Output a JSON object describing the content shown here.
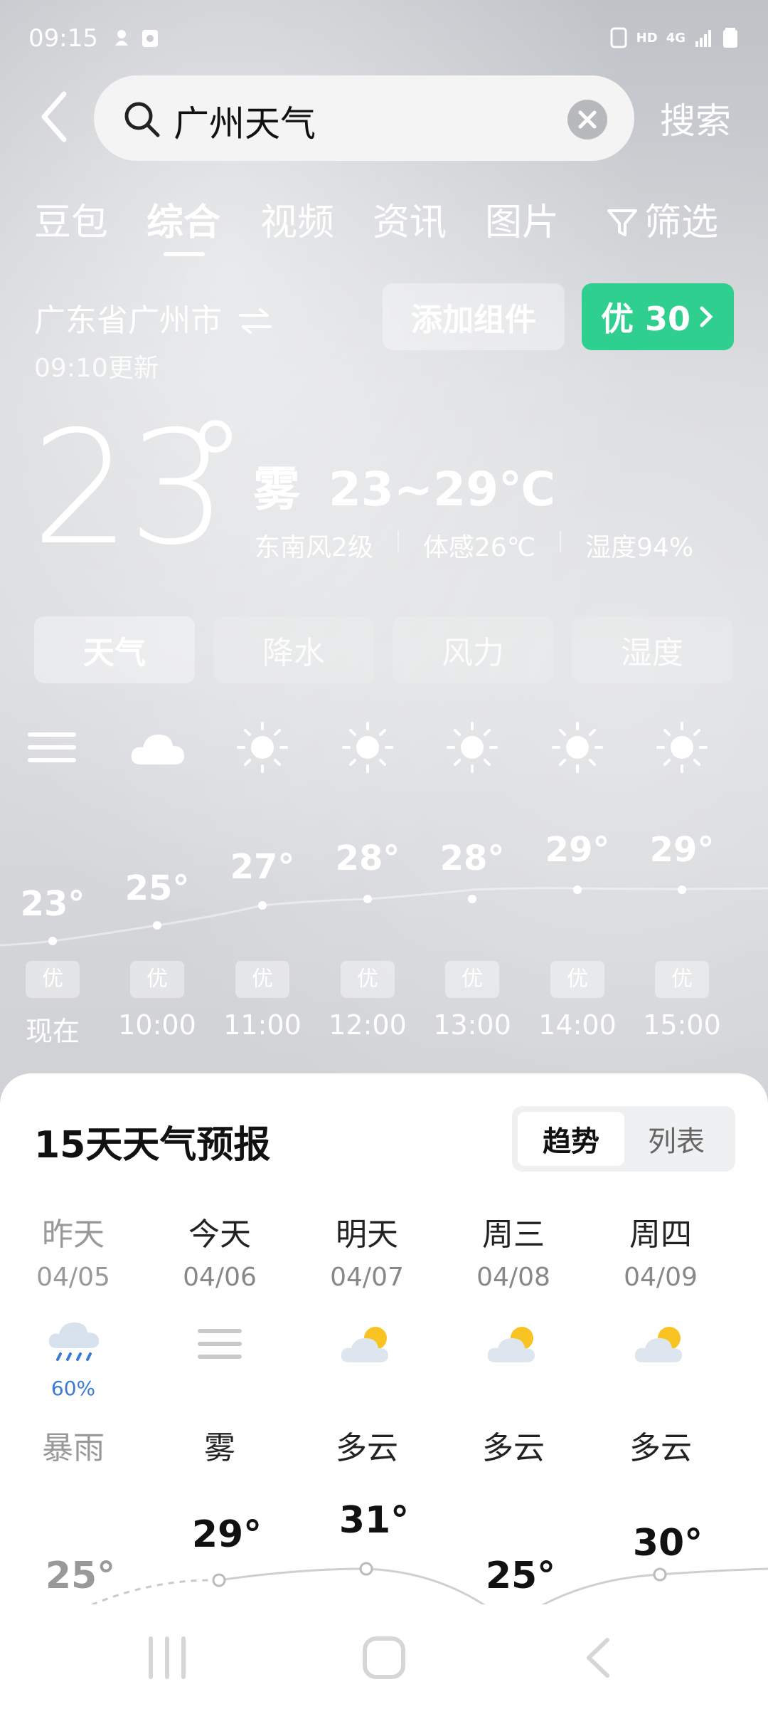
{
  "status_bar": {
    "time": "09:15",
    "indicators": [
      "HD",
      "4G"
    ],
    "icons": [
      "notification-icon",
      "calendar-icon",
      "nfc-icon",
      "signal-icon",
      "battery-icon"
    ]
  },
  "search": {
    "query": "广州天气",
    "search_button": "搜索"
  },
  "tabs": [
    {
      "label": "豆包",
      "active": false
    },
    {
      "label": "综合",
      "active": true
    },
    {
      "label": "视频",
      "active": false
    },
    {
      "label": "资讯",
      "active": false
    },
    {
      "label": "图片",
      "active": false
    },
    {
      "label": "筛选",
      "active": false
    }
  ],
  "location": {
    "name": "广东省广州市",
    "updated": "09:10更新"
  },
  "buttons": {
    "add_widget": "添加组件",
    "aqi": "优 30"
  },
  "current": {
    "temp": "23",
    "condition": "雾",
    "range": "23~29℃",
    "wind": "东南风2级",
    "feels_like": "体感26℃",
    "humidity": "湿度94%"
  },
  "segments": [
    {
      "label": "天气",
      "active": true
    },
    {
      "label": "降水",
      "active": false
    },
    {
      "label": "风力",
      "active": false
    },
    {
      "label": "湿度",
      "active": false
    }
  ],
  "hourly": [
    {
      "time": "现在",
      "temp": "23°",
      "aqi": "优",
      "icon": "fog-icon"
    },
    {
      "time": "10:00",
      "temp": "25°",
      "aqi": "优",
      "icon": "cloud-icon"
    },
    {
      "time": "11:00",
      "temp": "27°",
      "aqi": "优",
      "icon": "sun-icon"
    },
    {
      "time": "12:00",
      "temp": "28°",
      "aqi": "优",
      "icon": "sun-icon"
    },
    {
      "time": "13:00",
      "temp": "28°",
      "aqi": "优",
      "icon": "sun-icon"
    },
    {
      "time": "14:00",
      "temp": "29°",
      "aqi": "优",
      "icon": "sun-icon"
    },
    {
      "time": "15:00",
      "temp": "29°",
      "aqi": "优",
      "icon": "sun-icon"
    }
  ],
  "forecast": {
    "title": "15天天气预报",
    "toggle": {
      "trend": "趋势",
      "list": "列表"
    },
    "days": [
      {
        "name": "昨天",
        "date": "04/05",
        "condition": "暴雨",
        "precip": "60%",
        "high": "25°",
        "icon": "rain-icon"
      },
      {
        "name": "今天",
        "date": "04/06",
        "condition": "雾",
        "precip": "",
        "high": "29°",
        "icon": "fog-icon"
      },
      {
        "name": "明天",
        "date": "04/07",
        "condition": "多云",
        "precip": "",
        "high": "31°",
        "icon": "partly-cloudy-icon"
      },
      {
        "name": "周三",
        "date": "04/08",
        "condition": "多云",
        "precip": "",
        "high": "25°",
        "icon": "partly-cloudy-icon"
      },
      {
        "name": "周四",
        "date": "04/09",
        "condition": "多云",
        "precip": "",
        "high": "30°",
        "icon": "partly-cloudy-icon"
      }
    ]
  },
  "colors": {
    "accent_green": "#2fcf8f",
    "rain_blue": "#3a7bd5"
  }
}
